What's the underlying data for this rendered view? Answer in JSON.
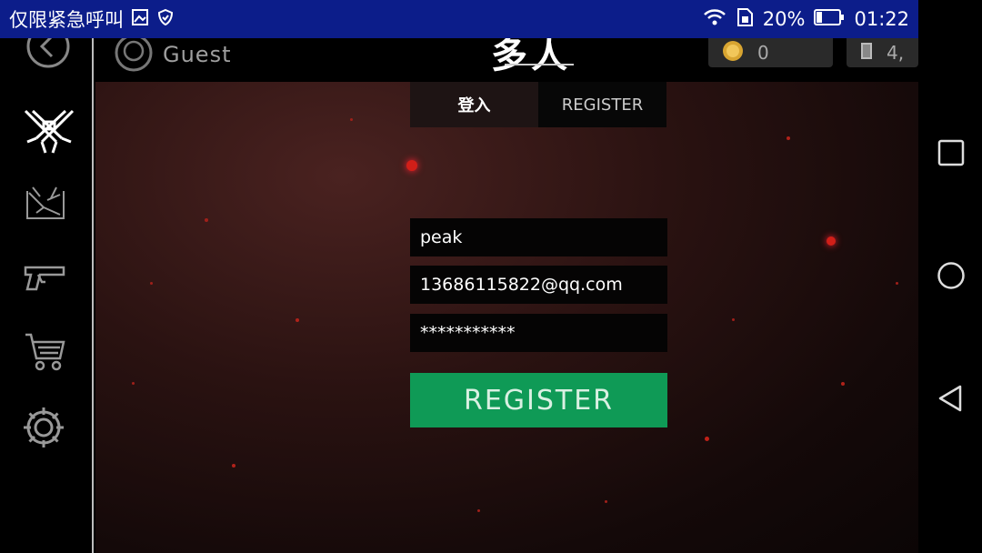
{
  "status_bar": {
    "left_text": "仅限紧急呼叫",
    "battery": "20%",
    "time": "01:22"
  },
  "header": {
    "guest_name": "Guest",
    "title": "多人",
    "currency_1_value": "0",
    "currency_2_value": "4,"
  },
  "tabs": {
    "login_label": "登入",
    "register_label": "REGISTER"
  },
  "form": {
    "username_value": "peak",
    "email_value": "13686115822@qq.com",
    "password_value": "***********",
    "register_button_label": "REGISTER"
  },
  "colors": {
    "status_bar_bg": "#0c1d8a",
    "register_button": "#0f9a56",
    "spark": "#e0281c"
  },
  "icons": {
    "sidebar": [
      "back-icon",
      "crossed-guns-icon",
      "map-icon",
      "pistol-icon",
      "cart-icon",
      "gear-icon"
    ],
    "navbar": [
      "recents-square-icon",
      "home-circle-icon",
      "back-triangle-icon"
    ]
  }
}
